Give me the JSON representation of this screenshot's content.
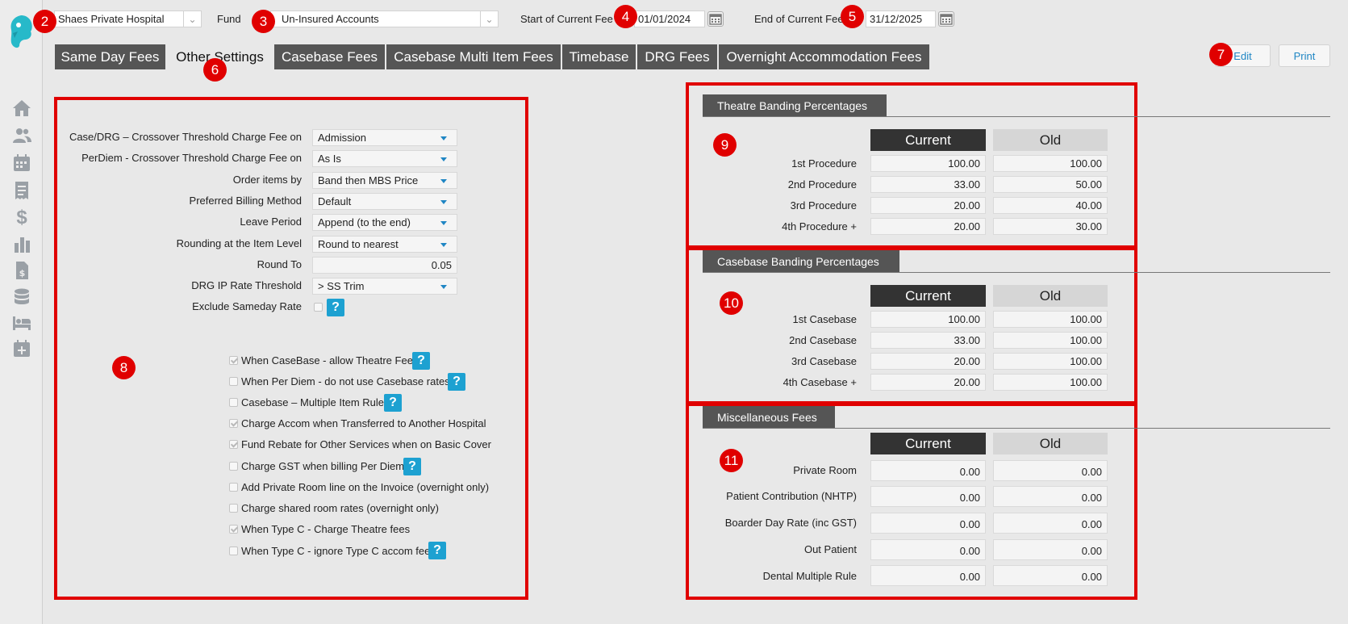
{
  "topbar": {
    "hospital": "Shaes Private Hospital",
    "fund_label": "Fund",
    "fund_value": "Un-Insured Accounts",
    "start_label": "Start of Current Fee",
    "start_value": "01/01/2024",
    "end_label": "End of Current Fee",
    "end_value": "31/12/2025"
  },
  "badges": [
    "2",
    "3",
    "4",
    "5",
    "6",
    "7",
    "8",
    "9",
    "10",
    "11"
  ],
  "tabs": [
    {
      "label": "Same Day Fees"
    },
    {
      "label": "Other Settings"
    },
    {
      "label": "Casebase Fees"
    },
    {
      "label": "Casebase Multi Item Fees"
    },
    {
      "label": "Timebase"
    },
    {
      "label": "DRG Fees"
    },
    {
      "label": "Overnight Accommodation Fees"
    }
  ],
  "actions": {
    "edit": "Edit",
    "print": "Print"
  },
  "settings": {
    "rows": [
      {
        "label": "Case/DRG – Crossover Threshold Charge Fee on",
        "value": "Admission"
      },
      {
        "label": "PerDiem - Crossover Threshold Charge Fee on",
        "value": "As Is"
      },
      {
        "label": "Order items by",
        "value": "Band then MBS Price"
      },
      {
        "label": "Preferred Billing Method",
        "value": "Default"
      },
      {
        "label": "Leave Period",
        "value": "Append (to the end)"
      },
      {
        "label": "Rounding at the Item Level",
        "value": "Round to nearest"
      },
      {
        "label": "Round To",
        "value": "0.05"
      },
      {
        "label": "DRG IP Rate Threshold",
        "value": "> SS Trim"
      },
      {
        "label": "Exclude Sameday Rate",
        "value": ""
      }
    ],
    "help_glyph": "?",
    "checks": [
      {
        "label": "When CaseBase - allow Theatre Fee",
        "checked": true
      },
      {
        "label": "When Per Diem - do not use Casebase rates",
        "checked": false
      },
      {
        "label": "Casebase – Multiple Item Rule",
        "checked": false
      },
      {
        "label": "Charge Accom when Transferred to Another Hospital",
        "checked": true
      },
      {
        "label": "Fund Rebate for Other Services when on Basic Cover",
        "checked": true
      },
      {
        "label": "Charge GST when billing Per Diem",
        "checked": false
      },
      {
        "label": "Add Private Room line on the Invoice (overnight only)",
        "checked": false
      },
      {
        "label": "Charge shared room rates (overnight only)",
        "checked": false
      },
      {
        "label": "When Type C - Charge Theatre fees",
        "checked": true
      },
      {
        "label": "When Type C - ignore Type C accom fee",
        "checked": false
      }
    ]
  },
  "theatre": {
    "title": "Theatre Banding Percentages",
    "current": "Current",
    "old": "Old",
    "rows": [
      {
        "label": "1st Procedure",
        "current": "100.00",
        "old": "100.00"
      },
      {
        "label": "2nd Procedure",
        "current": "33.00",
        "old": "50.00"
      },
      {
        "label": "3rd Procedure",
        "current": "20.00",
        "old": "40.00"
      },
      {
        "label": "4th Procedure +",
        "current": "20.00",
        "old": "30.00"
      }
    ]
  },
  "casebase": {
    "title": "Casebase Banding Percentages",
    "current": "Current",
    "old": "Old",
    "rows": [
      {
        "label": "1st Casebase",
        "current": "100.00",
        "old": "100.00"
      },
      {
        "label": "2nd Casebase",
        "current": "33.00",
        "old": "100.00"
      },
      {
        "label": "3rd Casebase",
        "current": "20.00",
        "old": "100.00"
      },
      {
        "label": "4th Casebase +",
        "current": "20.00",
        "old": "100.00"
      }
    ]
  },
  "misc": {
    "title": "Miscellaneous Fees",
    "current": "Current",
    "old": "Old",
    "rows": [
      {
        "label": "Private Room",
        "current": "0.00",
        "old": "0.00"
      },
      {
        "label": "Patient Contribution (NHTP)",
        "current": "0.00",
        "old": "0.00"
      },
      {
        "label": "Boarder Day Rate (inc GST)",
        "current": "0.00",
        "old": "0.00"
      },
      {
        "label": "Out Patient",
        "current": "0.00",
        "old": "0.00"
      },
      {
        "label": "Dental Multiple Rule",
        "current": "0.00",
        "old": "0.00"
      }
    ]
  },
  "colors": {
    "accent": "#1f86c4",
    "tab_bg": "#555555",
    "annotation_red": "#e00000",
    "help_blue": "#1da1d1"
  }
}
